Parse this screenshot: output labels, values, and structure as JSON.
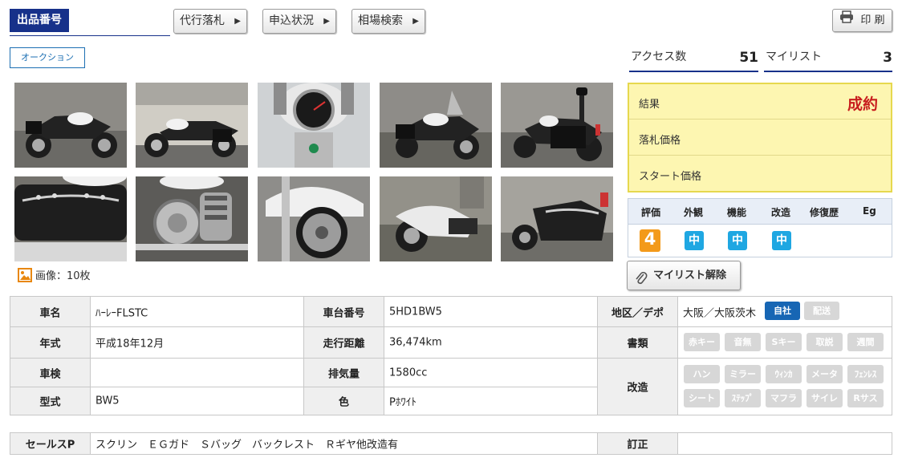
{
  "header": {
    "label": "出品番号",
    "buttons": [
      "代行落札",
      "申込状況",
      "相場検索"
    ],
    "print_label": "印 刷",
    "tag": "オークション"
  },
  "stats": {
    "access_label": "アクセス数",
    "access_value": "51",
    "mylist_label": "マイリスト",
    "mylist_value": "3"
  },
  "photos": {
    "count_label": "画像：10枚",
    "items": [
      "bike-photo",
      "bike-photo",
      "meter-photo",
      "bike-photo",
      "bike-photo",
      "saddlebag-photo",
      "engine-photo",
      "wheel-photo",
      "bike-photo",
      "saddlebag-photo"
    ]
  },
  "result": {
    "rows": [
      {
        "label": "結果",
        "value": "成約"
      },
      {
        "label": "落札価格",
        "value": ""
      },
      {
        "label": "スタート価格",
        "value": ""
      }
    ]
  },
  "evaluation": {
    "headers": [
      "評価",
      "外観",
      "機能",
      "改造",
      "修復歴",
      "Eg"
    ],
    "values": [
      "4",
      "中",
      "中",
      "中",
      "",
      ""
    ]
  },
  "mylist_button": "マイリスト解除",
  "spec": {
    "name_label": "車名",
    "name_value": "ﾊｰﾚｰFLSTC",
    "frame_label": "車台番号",
    "frame_value": "5HD1BW5",
    "region_label": "地区／デポ",
    "region_value": "大阪／大阪茨木",
    "region_chips": [
      {
        "label": "自社",
        "on": true
      },
      {
        "label": "配送",
        "on": false
      }
    ],
    "year_label": "年式",
    "year_value": "平成18年12月",
    "mileage_label": "走行距離",
    "mileage_value": "36,474km",
    "docs_label": "書類",
    "docs_chips": [
      "赤キー",
      "音無",
      "Sキー",
      "取説",
      "週間"
    ],
    "inspect_label": "車検",
    "inspect_value": "",
    "displacement_label": "排気量",
    "displacement_value": "1580cc",
    "model_label": "型式",
    "model_value": "BW5",
    "color_label": "色",
    "color_value": "Pﾎﾜｲﾄ",
    "mod_label": "改造",
    "mod_chips_row1": [
      "ハン",
      "ミラー",
      "ｳｨﾝｶ",
      "メータ",
      "ﾌｪﾝﾚｽ"
    ],
    "mod_chips_row2": [
      "シート",
      "ｽﾃｯﾌﾟ",
      "マフラ",
      "サイレ",
      "Rサス"
    ]
  },
  "sales": {
    "label": "セールスP",
    "value": "スクリン　ＥＧガド　Ｓバッグ　バックレスト　Ｒギヤ他改造有",
    "correction_label": "訂正",
    "correction_value": ""
  },
  "colors": {
    "navy": "#17318a",
    "result_red": "#c81e1e",
    "badge_orange": "#f39a1a",
    "badge_blue": "#1fa7e2",
    "chip_active": "#1766b4"
  }
}
